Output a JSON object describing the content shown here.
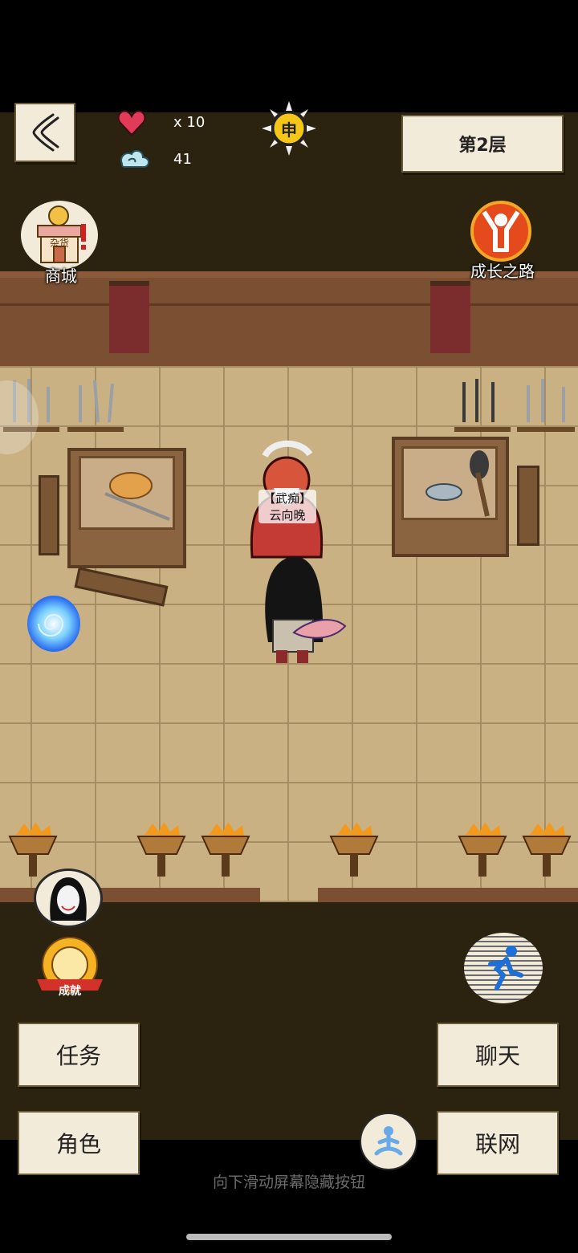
{
  "hud": {
    "lives": "x 10",
    "spirit": "41",
    "time_glyph": "申",
    "floor_label": "第2层"
  },
  "shortcuts": {
    "shop_label": "商城",
    "shop_sign": "杂货",
    "growth_label": "成长之路",
    "achievement_label": "成就"
  },
  "npc": {
    "title": "【武痴】",
    "name": "云向晚"
  },
  "buttons": {
    "tasks": "任务",
    "chat": "聊天",
    "role": "角色",
    "online": "联网"
  },
  "hint": "向下滑动屏幕隐藏按钮",
  "colors": {
    "background": "#2b220f",
    "floor": "#c9b184",
    "wall": "#7a4f32",
    "paper_button": "#f3ebda"
  }
}
